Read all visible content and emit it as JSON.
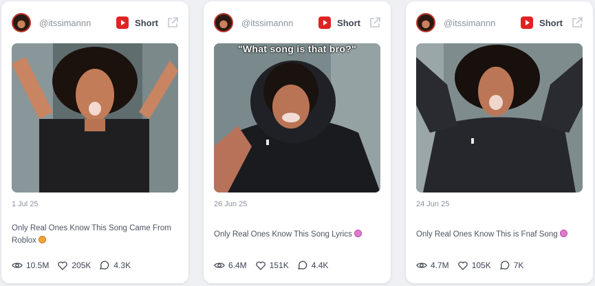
{
  "cards": [
    {
      "handle": "@itssimannn",
      "platform_label": "Short",
      "caption": "",
      "date": "1 Jul 25",
      "title": "Only Real Ones Know This Song Came From Roblox",
      "emoji": "angry-face",
      "views": "10.5M",
      "likes": "205K",
      "comments": "4.3K"
    },
    {
      "handle": "@itssimannn",
      "platform_label": "Short",
      "caption": "\"What song is that bro?\"",
      "date": "26 Jun 25",
      "title": "Only Real Ones Know This Song Lyrics",
      "emoji": "crying-face",
      "views": "6.4M",
      "likes": "151K",
      "comments": "4.4K"
    },
    {
      "handle": "@itssimannn",
      "platform_label": "Short",
      "caption": "",
      "date": "24 Jun 25",
      "title": "Only Real Ones Know This is Fnaf Song",
      "emoji": "crying-face",
      "views": "4.7M",
      "likes": "105K",
      "comments": "7K"
    }
  ],
  "colors": {
    "background": "#eef0f4",
    "card": "#ffffff",
    "youtube_red": "#e02323",
    "text_muted": "#8b919b",
    "text_body": "#4c5260"
  }
}
